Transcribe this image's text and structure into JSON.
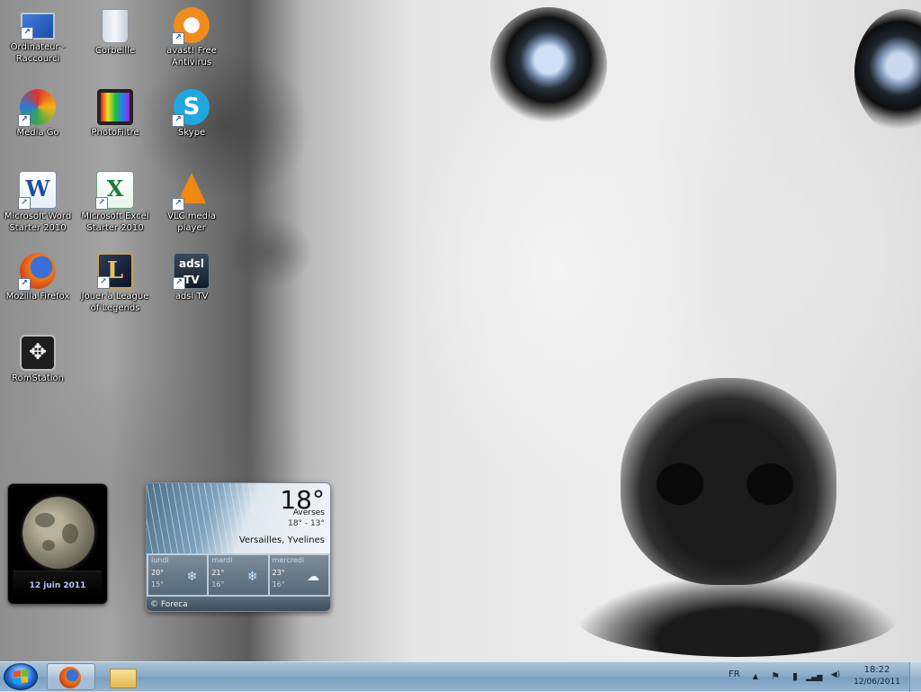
{
  "desktop": {
    "icons": [
      {
        "label": "Ordinateur - Raccourci",
        "icon": "computer-icon"
      },
      {
        "label": "Corbeille",
        "icon": "recycle-bin-icon"
      },
      {
        "label": "avast! Free Antivirus",
        "icon": "avast-icon"
      },
      {
        "label": "Media Go",
        "icon": "media-go-icon"
      },
      {
        "label": "PhotoFiltre",
        "icon": "photofiltre-icon"
      },
      {
        "label": "Skype",
        "icon": "skype-icon"
      },
      {
        "label": "Microsoft Word Starter 2010",
        "icon": "word-icon"
      },
      {
        "label": "Microsoft Excel Starter 2010",
        "icon": "excel-icon"
      },
      {
        "label": "VLC media player",
        "icon": "vlc-icon"
      },
      {
        "label": "Mozilla Firefox",
        "icon": "firefox-icon"
      },
      {
        "label": "Jouer à League of Legends",
        "icon": "league-of-legends-icon"
      },
      {
        "label": "adsl TV",
        "icon": "adsl-tv-icon"
      },
      {
        "label": "RomStation",
        "icon": "romstation-icon"
      }
    ],
    "glyphs": {
      "skype": "S",
      "word": "W",
      "excel": "X",
      "lol": "L",
      "adsl_line1": "adsl",
      "adsl_line2": "TV",
      "romstation": "✥",
      "shortcut": "↗"
    }
  },
  "moon_gadget": {
    "date": "12 juin 2011"
  },
  "weather_gadget": {
    "temperature": "18°",
    "condition": "Averses",
    "hi_lo": "18° - 13°",
    "location": "Versailles, Yvelines",
    "forecast": [
      {
        "day": "lundi",
        "high": "20°",
        "low": "15°",
        "icon": "rain-icon",
        "glyph": "❄"
      },
      {
        "day": "mardi",
        "high": "21°",
        "low": "16°",
        "icon": "rain-icon",
        "glyph": "❄"
      },
      {
        "day": "mercredi",
        "high": "23°",
        "low": "16°",
        "icon": "cloud-icon",
        "glyph": "☁"
      }
    ],
    "credit": "© Foreca"
  },
  "taskbar": {
    "language": "FR",
    "time": "18:22",
    "date": "12/06/2011",
    "tray_glyphs": {
      "arrow": "▲",
      "flag": "⚑",
      "battery": "▮",
      "signal": "▂▄▆",
      "volume": "◀)"
    }
  },
  "colors": {
    "taskbar": "#8aacc8",
    "moon_date": "#b9c6ff"
  }
}
